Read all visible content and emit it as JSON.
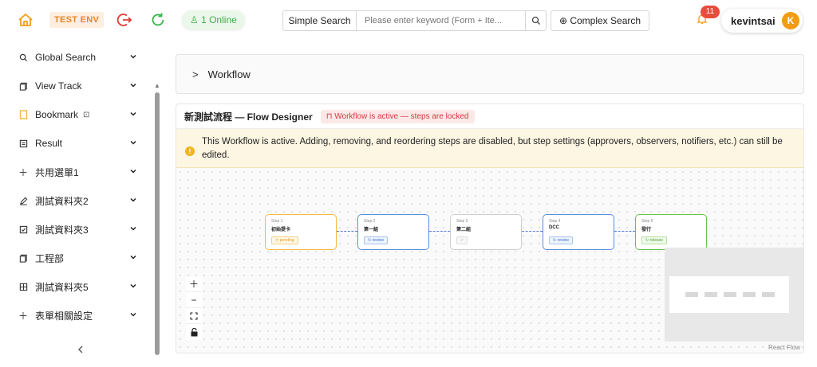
{
  "header": {
    "env": "TEST ENV",
    "online": "1 Online",
    "search_label": "Simple Search",
    "search_placeholder": "Please enter keyword (Form + Ite...",
    "complex_search": "Complex Search",
    "notifications": "11",
    "username": "kevintsai",
    "avatar_letter": "K"
  },
  "sidebar": {
    "items": [
      {
        "label": "Global Search",
        "icon": "search-icon"
      },
      {
        "label": "View Track",
        "icon": "copy-icon"
      },
      {
        "label": "Bookmark",
        "icon": "bookmark-icon"
      },
      {
        "label": "Result",
        "icon": "list-icon"
      },
      {
        "label": "共用選單1",
        "icon": "plus-icon"
      },
      {
        "label": "測試資料夾2",
        "icon": "edit-icon"
      },
      {
        "label": "測試資料夾3",
        "icon": "checkbox-icon"
      },
      {
        "label": "工程部",
        "icon": "copy-icon"
      },
      {
        "label": "測試資料夾5",
        "icon": "grid-icon"
      },
      {
        "label": "表單相關設定",
        "icon": "plus-icon"
      }
    ]
  },
  "workflow_panel": {
    "label": "Workflow"
  },
  "designer": {
    "title": "新測試流程 — Flow Designer",
    "locked_badge": "Workflow is active — steps are locked",
    "alert": "This Workflow is active. Adding, removing, and reordering steps are disabled, but step settings (approvers, observers, notifiers, etc.) can still be edited.",
    "attribution": "React Flow",
    "nodes": [
      {
        "step": "Step 1",
        "name": "初始提卡",
        "tag": "pending",
        "color": "#f5b942"
      },
      {
        "step": "Step 2",
        "name": "第一組",
        "tag": "review",
        "color": "#5b8de0"
      },
      {
        "step": "Step 3",
        "name": "第二組",
        "tag": "",
        "color": "#cccccc"
      },
      {
        "step": "Step 4",
        "name": "DCC",
        "tag": "review",
        "color": "#5b8de0"
      },
      {
        "step": "Step 5",
        "name": "發行",
        "tag": "release",
        "color": "#6cc24a"
      }
    ]
  }
}
